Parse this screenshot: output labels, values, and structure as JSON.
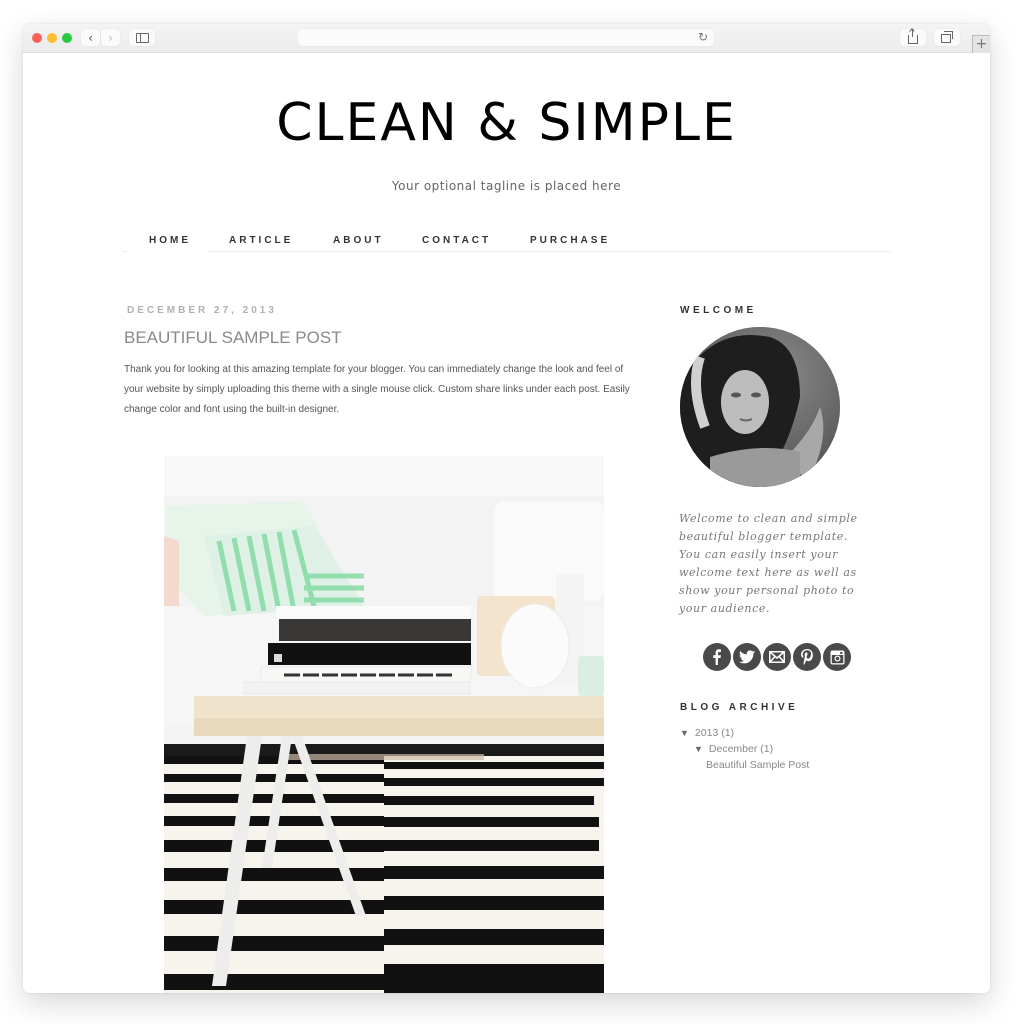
{
  "browser": {
    "nav_back_glyph": "‹",
    "nav_forward_glyph": "›",
    "reload_glyph": "↻",
    "new_tab_glyph": "+",
    "icons": [
      "close-window",
      "minimize-window",
      "zoom-window",
      "back",
      "forward",
      "sidebar",
      "reload",
      "share",
      "tabs-overview",
      "new-tab"
    ]
  },
  "site": {
    "title": "CLEAN & SIMPLE",
    "tagline": "Your optional tagline is placed here"
  },
  "nav": {
    "items": [
      {
        "label": "HOME",
        "active": true
      },
      {
        "label": "ARTICLE",
        "active": false
      },
      {
        "label": "ABOUT",
        "active": false
      },
      {
        "label": "CONTACT",
        "active": false
      },
      {
        "label": "PURCHASE",
        "active": false
      }
    ]
  },
  "post": {
    "date": "DECEMBER 27, 2013",
    "title": "BEAUTIFUL SAMPLE POST",
    "body": "Thank you for looking at this amazing template for your blogger. You can immediately change the look and feel of your website by simply uploading this theme with a single mouse click. Custom share links under each post. Easily change color and font using the built-in designer.",
    "image_alt": "coffee-table-with-books-and-striped-rug"
  },
  "sidebar": {
    "welcome": {
      "title": "WELCOME",
      "text": "Welcome to clean and simple beautiful blogger template. You can easily insert your welcome text here as well as show your personal photo to your audience."
    },
    "social": [
      {
        "name": "facebook",
        "glyph": "f"
      },
      {
        "name": "twitter",
        "glyph": "t"
      },
      {
        "name": "email",
        "glyph": "✉"
      },
      {
        "name": "pinterest",
        "glyph": "p"
      },
      {
        "name": "instagram",
        "glyph": "◙"
      }
    ],
    "archive": {
      "title": "BLOG ARCHIVE",
      "expand_glyph": "▼",
      "year": "2013",
      "year_count": "(1)",
      "month": "December",
      "month_count": "(1)",
      "post": "Beautiful Sample Post"
    }
  },
  "colors": {
    "title": "#000000",
    "nav_text": "#333333",
    "date": "#b0b0b0",
    "post_title": "#8a8a8a",
    "body": "#555555",
    "social_bg": "#4a4a4a",
    "archive_text": "#888888"
  }
}
